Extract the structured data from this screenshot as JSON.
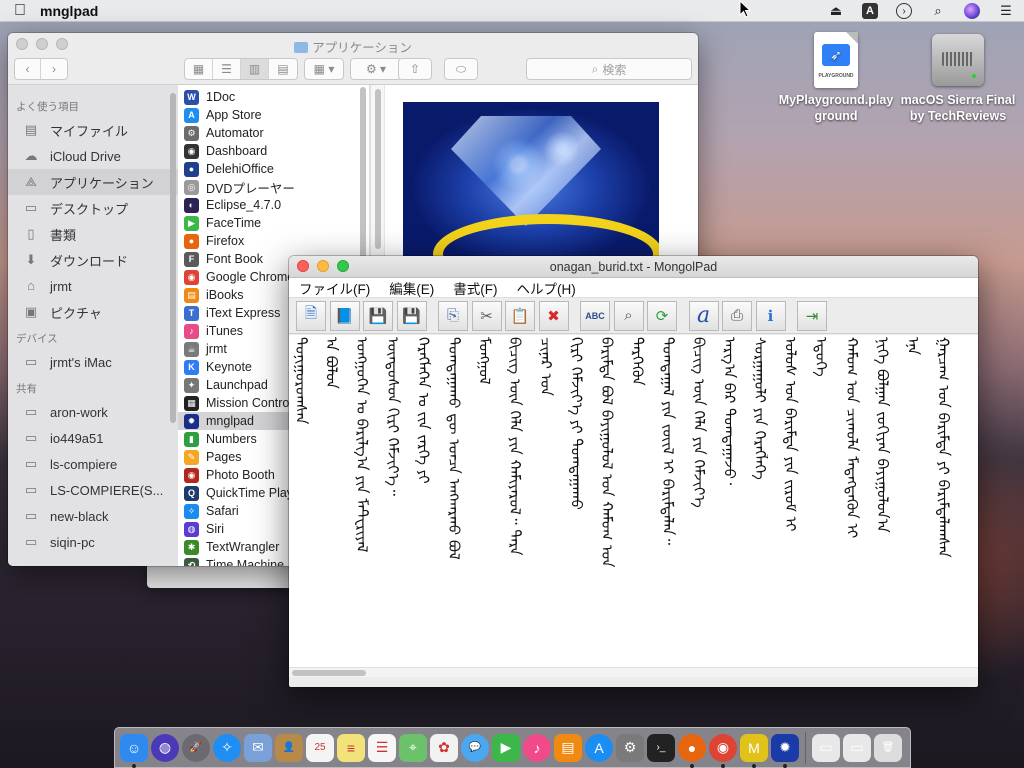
{
  "menubar": {
    "app_name": "mnglpad",
    "icons": [
      "apple-icon",
      "eject-icon",
      "input-source-icon",
      "timemachine-icon",
      "spotlight-icon",
      "siri-icon",
      "notification-center-icon"
    ],
    "input_source_label": "A"
  },
  "desktop": {
    "icons": [
      {
        "label": "MyPlayground.playground",
        "icon": "playground-file-icon"
      },
      {
        "label": "macOS Sierra Final by TechReviews",
        "icon": "disk-image-icon"
      }
    ]
  },
  "finder": {
    "title": "アプリケーション",
    "search_placeholder": "検索",
    "sidebar": {
      "sections": [
        {
          "heading": "よく使う項目",
          "items": [
            {
              "label": "マイファイル",
              "icon": "all-files-icon"
            },
            {
              "label": "iCloud Drive",
              "icon": "cloud-icon"
            },
            {
              "label": "アプリケーション",
              "icon": "applications-icon",
              "selected": true
            },
            {
              "label": "デスクトップ",
              "icon": "desktop-icon"
            },
            {
              "label": "書類",
              "icon": "documents-icon"
            },
            {
              "label": "ダウンロード",
              "icon": "downloads-icon"
            },
            {
              "label": "jrmt",
              "icon": "home-icon"
            },
            {
              "label": "ピクチャ",
              "icon": "pictures-icon"
            }
          ]
        },
        {
          "heading": "デバイス",
          "items": [
            {
              "label": "jrmt's iMac",
              "icon": "imac-icon"
            }
          ]
        },
        {
          "heading": "共有",
          "items": [
            {
              "label": "aron-work",
              "icon": "network-computer-icon"
            },
            {
              "label": "io449a51",
              "icon": "network-computer-icon"
            },
            {
              "label": "ls-compiere",
              "icon": "network-computer-icon"
            },
            {
              "label": "LS-COMPIERE(S...",
              "icon": "network-computer-icon"
            },
            {
              "label": "new-black",
              "icon": "network-computer-icon"
            },
            {
              "label": "siqin-pc",
              "icon": "network-computer-icon"
            }
          ]
        }
      ]
    },
    "files": [
      {
        "name": "1Doc",
        "color": "#2b4fa8",
        "glyph": "W"
      },
      {
        "name": "App Store",
        "color": "#1c8ef2",
        "glyph": "A"
      },
      {
        "name": "Automator",
        "color": "#6b6b6b",
        "glyph": "⚙"
      },
      {
        "name": "Dashboard",
        "color": "#333333",
        "glyph": "◉"
      },
      {
        "name": "DelehiOffice",
        "color": "#1f3f8f",
        "glyph": "●"
      },
      {
        "name": "DVDプレーヤー",
        "color": "#9a9a9a",
        "glyph": "◎"
      },
      {
        "name": "Eclipse_4.7.0",
        "color": "#2c2255",
        "glyph": "◐"
      },
      {
        "name": "FaceTime",
        "color": "#3cb84a",
        "glyph": "▶"
      },
      {
        "name": "Firefox",
        "color": "#e8650f",
        "glyph": "●"
      },
      {
        "name": "Font Book",
        "color": "#5a5a5a",
        "glyph": "F"
      },
      {
        "name": "Google Chrome",
        "color": "#dd4433",
        "glyph": "◉"
      },
      {
        "name": "iBooks",
        "color": "#f08a12",
        "glyph": "▤"
      },
      {
        "name": "iText Express",
        "color": "#3a6fd0",
        "glyph": "T"
      },
      {
        "name": "iTunes",
        "color": "#e84a8a",
        "glyph": "♪"
      },
      {
        "name": "jrmt",
        "color": "#7a7a7a",
        "glyph": "☕"
      },
      {
        "name": "Keynote",
        "color": "#2e7cf6",
        "glyph": "K"
      },
      {
        "name": "Launchpad",
        "color": "#777777",
        "glyph": "✦"
      },
      {
        "name": "Mission Control",
        "color": "#222222",
        "glyph": "▦"
      },
      {
        "name": "mnglpad",
        "color": "#1a2d8a",
        "glyph": "✹",
        "selected": true
      },
      {
        "name": "Numbers",
        "color": "#2f9e3f",
        "glyph": "▮"
      },
      {
        "name": "Pages",
        "color": "#f5a623",
        "glyph": "✎"
      },
      {
        "name": "Photo Booth",
        "color": "#b3261e",
        "glyph": "◉"
      },
      {
        "name": "QuickTime Player",
        "color": "#1d3c6e",
        "glyph": "Q"
      },
      {
        "name": "Safari",
        "color": "#1a8cf0",
        "glyph": "✧"
      },
      {
        "name": "Siri",
        "color": "#5a3ccf",
        "glyph": "◍"
      },
      {
        "name": "TextWrangler",
        "color": "#3a8a2a",
        "glyph": "✱"
      },
      {
        "name": "Time Machine",
        "color": "#3a5a3a",
        "glyph": "⟲"
      }
    ]
  },
  "mongolpad": {
    "title": "onagan_burid.txt - MongolPad",
    "menus": [
      "ファイル(F)",
      "編集(E)",
      "書式(F)",
      "ヘルプ(H)"
    ],
    "toolbar": [
      {
        "name": "new-icon",
        "glyph": "🗎",
        "color": "#2f7ad6"
      },
      {
        "name": "open-icon",
        "glyph": "📘",
        "color": "#2f5fb0"
      },
      {
        "name": "save-icon",
        "glyph": "💾",
        "color": "#1e58b8"
      },
      {
        "name": "save-as-icon",
        "glyph": "💾",
        "color": "#1e58b8"
      },
      {
        "name": "copy-icon",
        "glyph": "⎘",
        "color": "#4a6fa8",
        "gap": true
      },
      {
        "name": "cut-icon",
        "glyph": "✂",
        "color": "#5a5a5a"
      },
      {
        "name": "paste-icon",
        "glyph": "📋",
        "color": "#c08a2a"
      },
      {
        "name": "delete-icon",
        "glyph": "✖",
        "color": "#d62a2a"
      },
      {
        "name": "spellcheck-icon",
        "glyph": "ABC",
        "color": "#2a4f8a",
        "gap": true
      },
      {
        "name": "find-icon",
        "glyph": "⌕",
        "color": "#555555"
      },
      {
        "name": "convert-icon",
        "glyph": "⟳",
        "color": "#2f9e3f"
      },
      {
        "name": "font-icon",
        "glyph": "a",
        "color": "#2a4fa8",
        "gap": true
      },
      {
        "name": "print-icon",
        "glyph": "⎙",
        "color": "#555555"
      },
      {
        "name": "info-icon",
        "glyph": "ℹ",
        "color": "#2f6fd0"
      },
      {
        "name": "exit-icon",
        "glyph": "⇥",
        "color": "#3a8a3a",
        "gap": true
      }
    ],
    "columns": [
      "ᠲᠣᠨᠢᠭᠤᠷᠣᠭᠰᠠᠨ",
      "ᠠ ᠪᠣᠯᠤᠨ",
      "ᠤᠩᠭᠤᠭᠡᠨ ᠤ ᠪᠠᠷᠢᠯᠭ᠎ᠠ ᠶᠢᠨ ᠮᠠᠲ᠋ᠧᠷᠢᠶᠠᠯ",
      "ᠦᠨᠳᠦᠰᠦᠨ ᠬᠢᠷᠢ ᠬᠡᠮᠵᠢᠶ᠎ᠡ᠃",
      "ᠬᠡᠷᠡᠭᠯᠡᠭᠡᠨ ᠤ ᠵᠢᠨ ᠵᠡᠷᠭᠡ ᠶᠢ",
      "ᠲᠣᠭᠲᠠᠭᠠᠬᠤ ᠳᠦ ᠣᠨᠴᠠ ᠠᠩᠬᠠᠷᠬᠤ ᠪᠣᠯ",
      "ᠮᠣᠩᠭᠣᠯ",
      "ᠪᠢᠴᠢᠭ ᠦᠨ ᠬᠡᠯᠡ ᠶᠢᠨ ᠬᠠᠮᠢᠶᠠᠷᠤᠯ᠃ ᠲᠡᠷᠡ",
      "ᠴᠢᠨᠠᠷ ᠤᠨ",
      "ᠬᠢᠷᠢ ᠬᠡᠮᠵᠢᠶ᠎ᠡ ᠶᠢ ᠲᠣᠭᠲᠠᠭᠠᠬᠤ",
      "ᠪᠠᠷᠢᠮᠲᠠ ᠪᠣᠯ ᠪᠠᠶᠢᠭᠤᠯᠤᠯ ᠤᠨ ᠬᠠᠮᠤᠭ ᠤᠨ",
      "ᠲᠡᠷᠭᠡᠭᠦᠨ",
      "ᠲᠣᠭᠲᠠᠭᠠᠯ ᠶᠢᠨ ᠵᠦᠢᠯ ᠢ ᠪᠠᠷᠢᠮᠲᠠᠯᠠᠨ᠃",
      "ᠪᠢᠴᠢᠭ ᠦᠨ ᠬᠡᠯᠡ ᠶᠢᠨ ᠬᠡᠮᠵᠢᠶ᠎ᠡ",
      "ᠠᠷᠭ᠎ᠠ ᠪᠠᠷ ᠲᠣᠭᠲᠠᠭᠠᠵᠤ᠂",
      "ᠰᠤᠷᠭᠠᠭᠤᠯᠢ ᠶᠢᠨ ᠬᠡᠷᠡᠭᠯᠡᠭᠡ",
      "ᠤᠯᠤᠰ ᠤᠨ ᠪᠠᠷᠢᠮᠲᠠ ᠶᠢᠨ ᠵᠢᠷᠤᠮ ᠢ",
      "ᠡᠳᠦᠭᠡ",
      "ᠬᠠᠮᠤᠭ ᠤᠨ ᠴᠢᠬᠤᠯᠠ ᠮᠡᠳᠡᠭᠳᠡᠬᠦᠨ ᠢ",
      "ᠨᠢᠭᠡ ᠪᠣᠯᠭᠠᠨ ᠵᠣᠬᠢᠶᠠᠨ ᠪᠠᠶᠢᠭᠤᠯᠤᠨ᠎ᠠ",
      "ᠡᠨᠡ",
      "ᠭᠠᠷᠴᠠᠭ ᠤᠨ ᠪᠠᠷᠢᠮᠲᠠ ᠶᠢ ᠪᠠᠷᠢᠮᠲᠠᠯᠠᠭᠰᠠᠨ"
    ]
  },
  "dock": {
    "apps": [
      {
        "name": "finder-icon",
        "color": "#2f8af0",
        "glyph": "☺",
        "running": true
      },
      {
        "name": "siri-icon",
        "color": "#4a3ab8",
        "glyph": "◍",
        "round": true
      },
      {
        "name": "launchpad-icon",
        "color": "#6a6a70",
        "glyph": "🚀",
        "round": true
      },
      {
        "name": "safari-icon",
        "color": "#1e8ef2",
        "glyph": "✧",
        "round": true
      },
      {
        "name": "mail-icon",
        "color": "#7aa0d8",
        "glyph": "✉"
      },
      {
        "name": "contacts-icon",
        "color": "#b88a4a",
        "glyph": "👤"
      },
      {
        "name": "calendar-icon",
        "color": "#f4f4f4",
        "glyph": "25",
        "dark": true
      },
      {
        "name": "notes-icon",
        "color": "#f3e27a",
        "glyph": "≡",
        "dark": true
      },
      {
        "name": "reminders-icon",
        "color": "#f6f6f6",
        "glyph": "☰",
        "dark": true
      },
      {
        "name": "maps-icon",
        "color": "#6cc26a",
        "glyph": "⌖"
      },
      {
        "name": "photos-icon",
        "color": "#f2f2f2",
        "glyph": "✿",
        "dark": true
      },
      {
        "name": "messages-icon",
        "color": "#4aa8f0",
        "glyph": "💬",
        "round": true
      },
      {
        "name": "facetime-icon",
        "color": "#3cb84a",
        "glyph": "▶"
      },
      {
        "name": "itunes-icon",
        "color": "#f04a8a",
        "glyph": "♪",
        "round": true
      },
      {
        "name": "ibooks-icon",
        "color": "#f08a12",
        "glyph": "▤"
      },
      {
        "name": "appstore-icon",
        "color": "#1c8ef2",
        "glyph": "A",
        "round": true
      },
      {
        "name": "system-preferences-icon",
        "color": "#7a7a7a",
        "glyph": "⚙"
      },
      {
        "name": "terminal-icon",
        "color": "#222222",
        "glyph": "›_"
      },
      {
        "name": "firefox-icon",
        "color": "#e8650f",
        "glyph": "●",
        "round": true,
        "running": true
      },
      {
        "name": "chrome-icon",
        "color": "#dd4433",
        "glyph": "◉",
        "round": true,
        "running": true
      },
      {
        "name": "mnglpad-dock-icon",
        "color": "#e0c21a",
        "glyph": "M",
        "running": true
      },
      {
        "name": "mnglpad-diamond-icon",
        "color": "#1a3aa8",
        "glyph": "✹",
        "running": true
      }
    ],
    "trailing": [
      {
        "name": "documents-stack-icon",
        "color": "#e8e8e8",
        "glyph": "▭"
      },
      {
        "name": "screenshot-stack-icon",
        "color": "#e8e8e8",
        "glyph": "▭"
      },
      {
        "name": "trash-icon",
        "color": "#dcdcdc",
        "glyph": "🗑"
      }
    ]
  }
}
